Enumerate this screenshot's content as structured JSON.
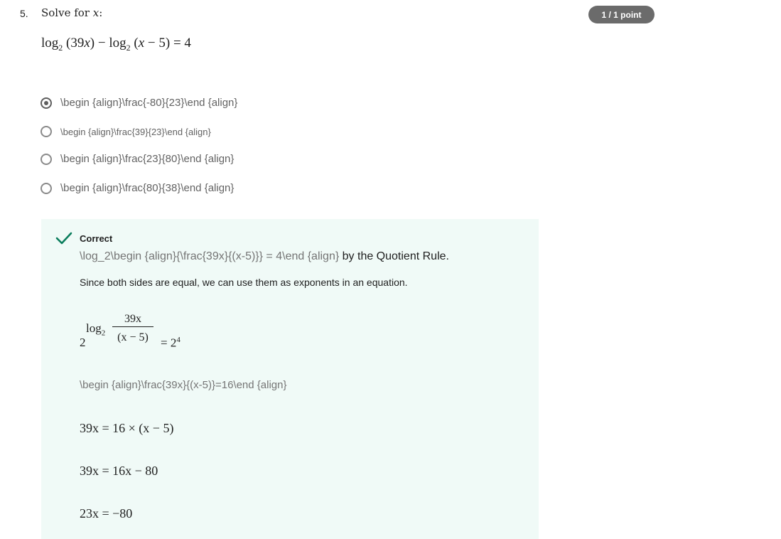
{
  "question": {
    "number": "5.",
    "prompt_text": "Solve for ",
    "prompt_var": "x",
    "prompt_colon": ":",
    "score": "1 / 1 point",
    "equation": {
      "log1": "log",
      "base1": "2",
      "arg1": "(39",
      "arg1_var": "x",
      "arg1_close": ")",
      "minus": " − ",
      "log2": "log",
      "base2": "2",
      "arg2": "(",
      "arg2_var": "x",
      "arg2_rest": " − 5)",
      "rhs": " = 4"
    }
  },
  "options": [
    {
      "label": "\\begin {align}\\frac{-80}{23}\\end {align}",
      "selected": true
    },
    {
      "label": "\\begin {align}\\frac{39}{23}\\end {align}",
      "selected": false
    },
    {
      "label": "\\begin {align}\\frac{23}{80}\\end {align}",
      "selected": false
    },
    {
      "label": "\\begin {align}\\frac{80}{38}\\end {align}",
      "selected": false
    }
  ],
  "feedback": {
    "status": "Correct",
    "status_color": "#0a7d5c",
    "background": "#f0faf7",
    "line1_raw": "\\log_2\\begin {align}{\\frac{39x}{(x-5)}} = 4\\end {align}",
    "line1_text": " by the Quotient Rule.",
    "line2": "Since both sides are equal, we can use them as exponents in an equation.",
    "exponent_eq": {
      "base": "2",
      "log": "log",
      "log_base": "2",
      "num": "39x",
      "den": "(x − 5)",
      "rhs": "= 2",
      "rhs_exp": "4"
    },
    "raw_line": "\\begin {align}\\frac{39x}{(x-5)}=16\\end {align}",
    "steps": [
      "39x = 16 × (x − 5)",
      "39x = 16x − 80",
      "23x = −80"
    ]
  }
}
